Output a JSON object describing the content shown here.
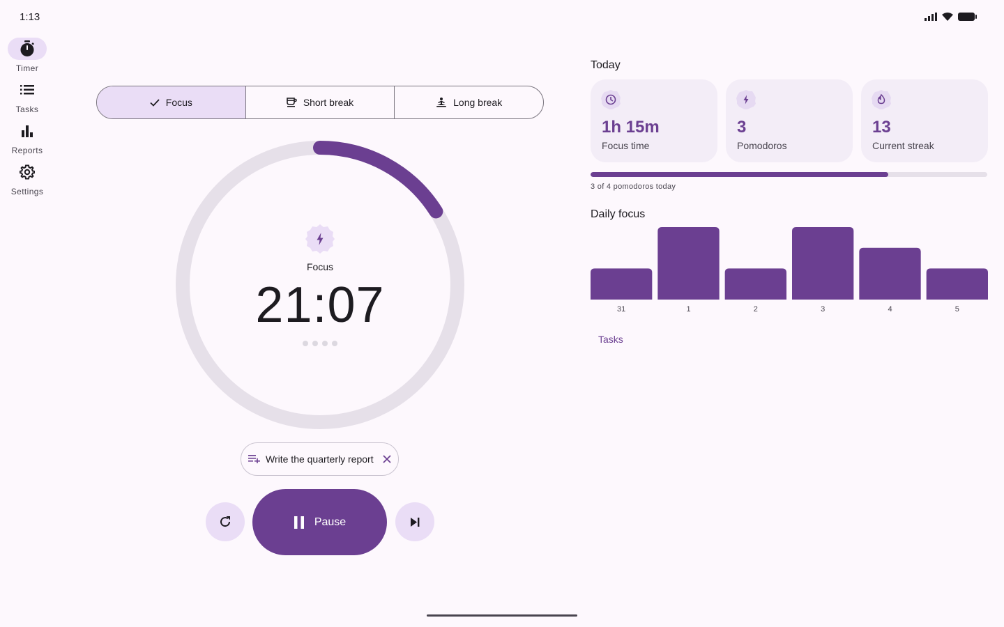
{
  "status": {
    "time": "1:13"
  },
  "rail": {
    "items": [
      {
        "label": "Timer",
        "icon": "timer-icon",
        "active": true
      },
      {
        "label": "Tasks",
        "icon": "list-icon",
        "active": false
      },
      {
        "label": "Reports",
        "icon": "bar-chart-icon",
        "active": false
      },
      {
        "label": "Settings",
        "icon": "gear-icon",
        "active": false
      }
    ]
  },
  "modes": [
    {
      "label": "Focus",
      "icon": "check-icon",
      "selected": true
    },
    {
      "label": "Short break",
      "icon": "coffee-icon",
      "selected": false
    },
    {
      "label": "Long break",
      "icon": "self-improvement-icon",
      "selected": false
    }
  ],
  "timer": {
    "mode_label": "Focus",
    "time": "21:07",
    "progress_fraction": 0.16,
    "session_dots": 4
  },
  "task": {
    "label": "Write the quarterly report"
  },
  "controls": {
    "pause_label": "Pause"
  },
  "today": {
    "heading": "Today",
    "stats": [
      {
        "value": "1h 15m",
        "label": "Focus time",
        "icon": "clock-icon"
      },
      {
        "value": "3",
        "label": "Pomodoros",
        "icon": "bolt-icon"
      },
      {
        "value": "13",
        "label": "Current streak",
        "icon": "flame-icon"
      }
    ],
    "progress_fraction": 0.75,
    "progress_caption": "3 of 4 pomodoros today"
  },
  "daily_focus": {
    "heading": "Daily focus"
  },
  "tasks_link": "Tasks",
  "colors": {
    "accent": "#6b3f91",
    "accent_container": "#eaddf6",
    "track": "#e6e0e9",
    "surface": "#fdf8fd"
  },
  "chart_data": {
    "type": "bar",
    "categories": [
      "31",
      "1",
      "2",
      "3",
      "4",
      "5"
    ],
    "values": [
      1.5,
      3.5,
      1.5,
      3.5,
      2.5,
      1.5
    ],
    "ylim": [
      0,
      3.5
    ],
    "grid": false
  }
}
